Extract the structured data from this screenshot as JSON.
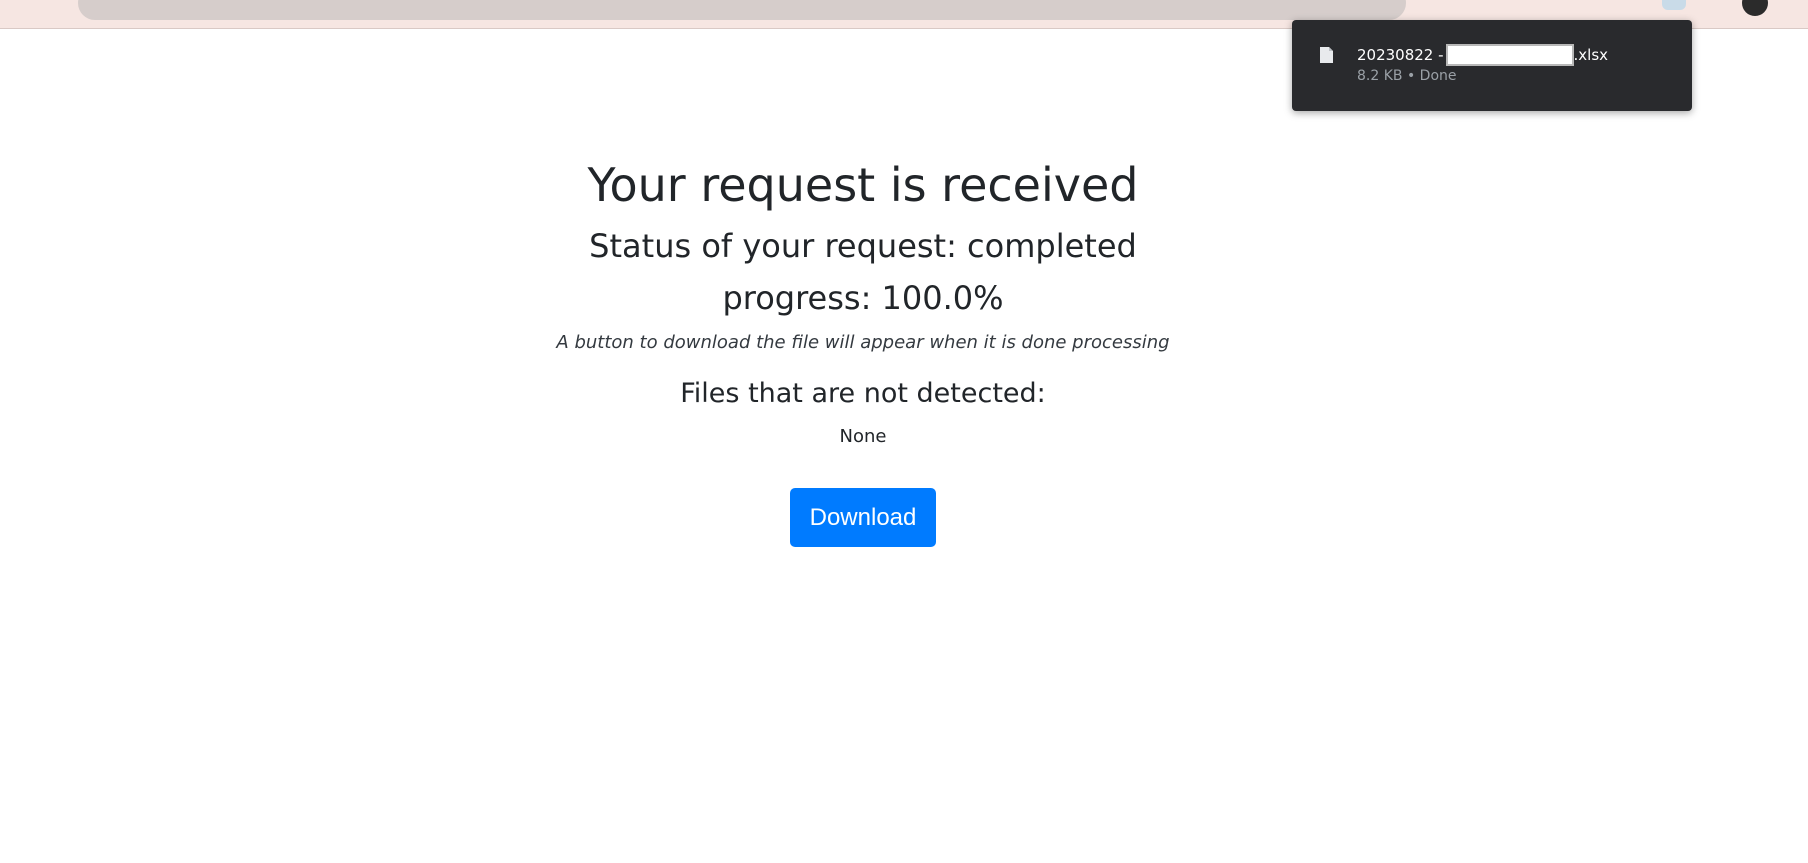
{
  "download_popup": {
    "file_name_prefix": "20230822 -",
    "file_name_suffix": ".xlsx",
    "file_meta": "8.2 KB • Done",
    "icon": "file-icon"
  },
  "main": {
    "title": "Your request is received",
    "status": "Status of your request: completed",
    "progress": "progress: 100.0%",
    "hint": "A button to download the file will appear when it is done processing",
    "undetected_heading": "Files that are not detected:",
    "undetected_value": "None",
    "download_label": "Download"
  },
  "colors": {
    "accent": "#007bff",
    "popup_bg": "#292a2d"
  }
}
